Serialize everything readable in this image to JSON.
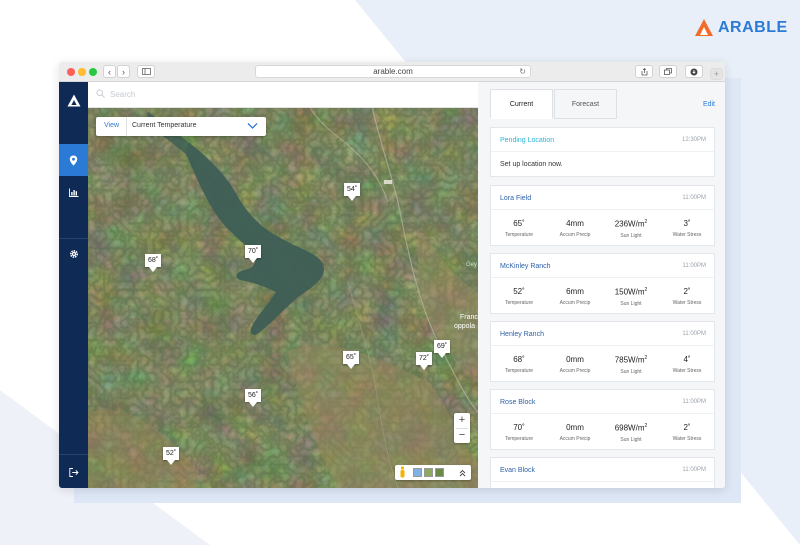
{
  "brand": {
    "name": "ARABLE",
    "color": "#2b7bd6",
    "accent": "#f26b2b"
  },
  "browser": {
    "url": "arable.com"
  },
  "sidebar": {
    "items": [
      {
        "name": "logo",
        "icon": "arable-logo-icon"
      },
      {
        "name": "map",
        "icon": "location-pin-icon",
        "active": true
      },
      {
        "name": "analytics",
        "icon": "bar-chart-icon"
      },
      {
        "name": "settings",
        "icon": "gear-icon"
      },
      {
        "name": "logout",
        "icon": "logout-icon"
      }
    ]
  },
  "search": {
    "placeholder": "Search"
  },
  "view_select": {
    "label": "View",
    "value": "Current Temperature"
  },
  "markers": [
    {
      "id": "m1",
      "value": "54˚"
    },
    {
      "id": "m2",
      "value": "70˚"
    },
    {
      "id": "m3",
      "value": "68˚"
    },
    {
      "id": "m4",
      "value": "65˚"
    },
    {
      "id": "m5",
      "value": "72˚"
    },
    {
      "id": "m6",
      "value": "69˚"
    },
    {
      "id": "m7",
      "value": "56˚"
    },
    {
      "id": "m8",
      "value": "52˚"
    }
  ],
  "map_labels": {
    "town_1": "Franc",
    "town_2": "oppola",
    "road": "Gey"
  },
  "zoom": {
    "in": "+",
    "out": "−"
  },
  "panel": {
    "tabs": [
      {
        "label": "Current",
        "active": true
      },
      {
        "label": "Forecast",
        "active": false
      }
    ],
    "edit_label": "Edit",
    "pending": {
      "title": "Pending Location",
      "time": "12:30PM",
      "message": "Set up location now."
    },
    "metric_labels": [
      "Temperature",
      "Accum Precip",
      "Sun Light",
      "Water Stress"
    ],
    "cards": [
      {
        "title": "Lora Field",
        "time": "11:00PM",
        "temp": "65˚",
        "precip": "4mm",
        "sun": "236W/m",
        "stress": "3˚"
      },
      {
        "title": "McKinley Ranch",
        "time": "11:00PM",
        "temp": "52˚",
        "precip": "6mm",
        "sun": "150W/m",
        "stress": "2˚"
      },
      {
        "title": "Henley Ranch",
        "time": "11:00PM",
        "temp": "68˚",
        "precip": "0mm",
        "sun": "785W/m",
        "stress": "4˚"
      },
      {
        "title": "Rose Block",
        "time": "11:00PM",
        "temp": "70˚",
        "precip": "0mm",
        "sun": "698W/m",
        "stress": "2˚"
      },
      {
        "title": "Evan Block",
        "time": "11:00PM"
      }
    ]
  }
}
